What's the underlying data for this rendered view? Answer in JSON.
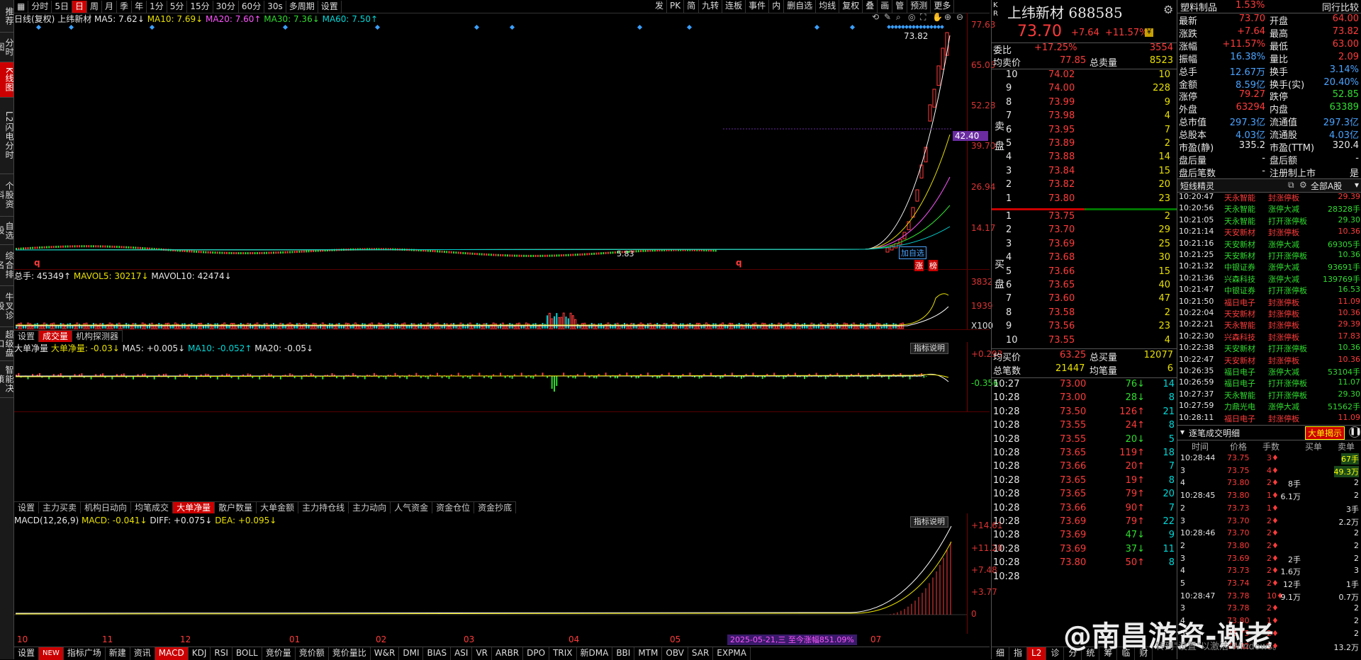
{
  "sidebar": [
    "推荐",
    "分时图",
    "K线图",
    "L2闪电分时",
    "个股资料",
    "自选股",
    "综合排名",
    "牛叉诊股",
    "超级盘口",
    "智能决策"
  ],
  "toolbar": {
    "left": [
      "分时",
      "5日",
      "日",
      "周",
      "月",
      "季",
      "年",
      "1分",
      "5分",
      "15分",
      "30分",
      "60分",
      "30s",
      "多周期",
      "设置"
    ],
    "active": "日",
    "right": [
      "发",
      "PK",
      "简",
      "九转",
      "连板",
      "事件",
      "内",
      "删自选",
      "均线",
      "复权",
      "叠",
      "画",
      "管",
      "预测",
      "更多"
    ]
  },
  "kline_legend": {
    "title": "日线(复权)",
    "name": "上纬新材",
    "ma5": "MA5: 7.62↓",
    "ma10": "MA10: 7.69↓",
    "ma20": "MA20: 7.60↑",
    "ma30": "MA30: 7.36↓",
    "ma60": "MA60: 7.50↑"
  },
  "kline_axis": [
    "77.63",
    "65.05",
    "52.28",
    "39.70",
    "26.94",
    "14.17"
  ],
  "kline_marker": "42.40",
  "kline_high": "73.82",
  "kline_low": "5.83",
  "kline_tags": [
    "加自选",
    "涨",
    "榜"
  ],
  "kline_q": [
    "q",
    "q"
  ],
  "vol_legend": {
    "total": "总手: 45349↑",
    "mavol5": "MAVOL5: 30217↓",
    "mavol10": "MAVOL10: 42474↓"
  },
  "vol_axis": [
    "3832",
    "1939",
    "X100"
  ],
  "vol_tabs": [
    "设置",
    "成交量",
    "机构探测器"
  ],
  "vol_tab_active": "成交量",
  "big_legend": {
    "title": "大单净量",
    "v": "大单净量: -0.03↓",
    "ma5": "MA5: +0.005↓",
    "ma10": "MA10: -0.052↑",
    "ma20": "MA20: -0.05↓"
  },
  "big_axis": [
    "+0.293",
    "-0.356"
  ],
  "indicator_btn": "指标说明",
  "big_tabs": [
    "设置",
    "主力买卖",
    "机构日动向",
    "均笔成交",
    "大单净量",
    "散户数量",
    "大单金额",
    "主力持仓线",
    "主力动向",
    "人气资金",
    "资金仓位",
    "资金抄底"
  ],
  "big_tab_active": "大单净量",
  "macd_legend": {
    "title": "MACD(12,26,9)",
    "macd": "MACD: -0.041↓",
    "diff": "DIFF: +0.075↓",
    "dea": "DEA: +0.095↓"
  },
  "macd_axis": [
    "+14.61",
    "+11.20",
    "+7.48",
    "+3.77",
    "0"
  ],
  "x_labels": [
    "10",
    "11",
    "12",
    "01",
    "02",
    "03",
    "04",
    "05",
    "06",
    "07"
  ],
  "date_tag": "2025-05-21,三 至今涨幅851.09%",
  "bottom_tabs": [
    "设置",
    "NEW",
    "指标广场",
    "新建",
    "资讯",
    "MACD",
    "KDJ",
    "RSI",
    "BOLL",
    "竞价量",
    "竞价额",
    "竞价量比",
    "W&R",
    "DMI",
    "BIAS",
    "ASI",
    "VR",
    "ARBR",
    "DPO",
    "TRIX",
    "新DMA",
    "BBI",
    "MTM",
    "OBV",
    "SAR",
    "EXPMA"
  ],
  "bottom_active": "MACD",
  "stock": {
    "name": "上纬新材",
    "code": "688585",
    "price": "73.70",
    "change": "+7.64",
    "pct": "+11.57%"
  },
  "weibi": {
    "label": "委比",
    "value": "+17.25%",
    "diff": "3554"
  },
  "avg_sell": {
    "label": "均卖价",
    "value": "77.85",
    "vol_label": "总卖量",
    "vol": "8523"
  },
  "sell_side": "卖盘",
  "buy_side": "买盘",
  "asks": [
    [
      "10",
      "74.02",
      "10"
    ],
    [
      "9",
      "74.00",
      "228"
    ],
    [
      "8",
      "73.99",
      "9"
    ],
    [
      "7",
      "73.98",
      "4"
    ],
    [
      "6",
      "73.95",
      "7"
    ],
    [
      "5",
      "73.89",
      "2"
    ],
    [
      "4",
      "73.88",
      "14"
    ],
    [
      "3",
      "73.84",
      "15"
    ],
    [
      "2",
      "73.82",
      "20"
    ],
    [
      "1",
      "73.80",
      "23"
    ]
  ],
  "bids": [
    [
      "1",
      "73.75",
      "2"
    ],
    [
      "2",
      "73.70",
      "29"
    ],
    [
      "3",
      "73.69",
      "25"
    ],
    [
      "4",
      "73.68",
      "30"
    ],
    [
      "5",
      "73.66",
      "15"
    ],
    [
      "6",
      "73.65",
      "40"
    ],
    [
      "7",
      "73.60",
      "47"
    ],
    [
      "8",
      "73.58",
      "2"
    ],
    [
      "9",
      "73.56",
      "23"
    ],
    [
      "10",
      "73.55",
      "4"
    ]
  ],
  "avg_buy": {
    "label": "均买价",
    "value": "63.25",
    "vol_label": "总买量",
    "vol": "12077"
  },
  "total_trades": {
    "label": "总笔数",
    "value": "21447",
    "vol_label": "均笔量",
    "vol": "6"
  },
  "ticks": [
    [
      "10:27",
      "73.00",
      "76↓",
      "14"
    ],
    [
      "10:28",
      "73.00",
      "28↓",
      "8"
    ],
    [
      "10:28",
      "73.50",
      "126↑",
      "21"
    ],
    [
      "10:28",
      "73.55",
      "24↑",
      "8"
    ],
    [
      "10:28",
      "73.55",
      "20↓",
      "5"
    ],
    [
      "10:28",
      "73.65",
      "119↑",
      "18"
    ],
    [
      "10:28",
      "73.66",
      "20↑",
      "7"
    ],
    [
      "10:28",
      "73.65",
      "19↑",
      "8"
    ],
    [
      "10:28",
      "73.65",
      "79↑",
      "20"
    ],
    [
      "10:28",
      "73.66",
      "90↑",
      "7"
    ],
    [
      "10:28",
      "73.69",
      "79↑",
      "22"
    ],
    [
      "10:28",
      "73.69",
      "47↓",
      "9"
    ],
    [
      "10:28",
      "73.69",
      "37↓",
      "11"
    ],
    [
      "10:28",
      "73.80",
      "50↑",
      "8"
    ],
    [
      "10:28",
      "",
      "",
      ""
    ]
  ],
  "quote_bottom_tabs": [
    "细",
    "指",
    "L2",
    "诊",
    "分",
    "统",
    "筹",
    "临",
    "财"
  ],
  "stats_header": {
    "name": "塑料制品",
    "pct": "1.53%",
    "right": "同行比较"
  },
  "stats": [
    [
      "最新",
      "73.70",
      "开盘",
      "64.00"
    ],
    [
      "涨跌",
      "+7.64",
      "最高",
      "73.82"
    ],
    [
      "涨幅",
      "+11.57%",
      "最低",
      "63.00"
    ],
    [
      "振幅",
      "16.38%",
      "量比",
      "2.09"
    ],
    [
      "总手",
      "12.67万",
      "换手",
      "3.14%"
    ],
    [
      "金额",
      "8.59亿",
      "换手(实)",
      "20.40%"
    ],
    [
      "涨停",
      "79.27",
      "跌停",
      "52.85"
    ],
    [
      "外盘",
      "63294",
      "内盘",
      "63389"
    ],
    [
      "总市值",
      "297.3亿",
      "流通值",
      "297.3亿"
    ],
    [
      "总股本",
      "4.03亿",
      "流通股",
      "4.03亿"
    ],
    [
      "市盈(静)",
      "335.2",
      "市盈(TTM)",
      "320.4"
    ],
    [
      "盘后量",
      "-",
      "盘后额",
      "-"
    ],
    [
      "盘后笔数",
      "-",
      "注册制上市",
      "是"
    ]
  ],
  "shortline": {
    "title": "短线精灵",
    "right": "全部A股"
  },
  "events": [
    [
      "10:20:47",
      "天永智能",
      "封涨停板",
      "29.39"
    ],
    [
      "10:20:56",
      "天永智能",
      "涨停大减",
      "28328手"
    ],
    [
      "10:21:05",
      "天永智能",
      "打开涨停板",
      "29.30"
    ],
    [
      "10:21:14",
      "天安新材",
      "封涨停板",
      "10.36"
    ],
    [
      "10:21:16",
      "天安新材",
      "涨停大减",
      "69305手"
    ],
    [
      "10:21:25",
      "天安新材",
      "打开涨停板",
      "10.36"
    ],
    [
      "10:21:32",
      "中银证券",
      "涨停大减",
      "93691手"
    ],
    [
      "10:21:36",
      "兴森科技",
      "涨停大减",
      "139769手"
    ],
    [
      "10:21:47",
      "中银证券",
      "打开涨停板",
      "16.53"
    ],
    [
      "10:21:50",
      "福日电子",
      "封涨停板",
      "11.09"
    ],
    [
      "10:22:04",
      "天安新材",
      "封涨停板",
      "10.36"
    ],
    [
      "10:22:21",
      "天永智能",
      "封涨停板",
      "29.39"
    ],
    [
      "10:22:30",
      "兴森科技",
      "封涨停板",
      "17.83"
    ],
    [
      "10:22:38",
      "天安新材",
      "打开涨停板",
      "10.36"
    ],
    [
      "10:22:47",
      "天安新材",
      "封涨停板",
      "10.36"
    ],
    [
      "10:26:35",
      "福日电子",
      "涨停大减",
      "53104手"
    ],
    [
      "10:26:59",
      "福日电子",
      "打开涨停板",
      "11.07"
    ],
    [
      "10:27:37",
      "天永智能",
      "打开涨停板",
      "29.30"
    ],
    [
      "10:27:59",
      "力鼎光电",
      "涨停大减",
      "51562手"
    ],
    [
      "10:28:11",
      "福日电子",
      "封涨停板",
      "11.09"
    ]
  ],
  "detail": {
    "title": "逐笔成交明细",
    "btn": "大单揭示",
    "cols": [
      "时间",
      "价格",
      "手数",
      "买单",
      "卖单"
    ]
  },
  "detail_rows": [
    [
      "10:28:44",
      "73.75",
      "3♦",
      "",
      "67手"
    ],
    [
      "3",
      "73.75",
      "4♦",
      "",
      "49.3万"
    ],
    [
      "4",
      "73.80",
      "2♦",
      "8手",
      "2"
    ],
    [
      "10:28:45",
      "73.80",
      "1♦",
      "6.1万",
      "2"
    ],
    [
      "2",
      "73.73",
      "1♦",
      "",
      "3手"
    ],
    [
      "3",
      "73.70",
      "2♦",
      "",
      "2.2万"
    ],
    [
      "10:28:46",
      "73.70",
      "2♦",
      "",
      "2"
    ],
    [
      "2",
      "73.80",
      "2♦",
      "",
      "2"
    ],
    [
      "3",
      "73.69",
      "2♦",
      "2手",
      "2"
    ],
    [
      "4",
      "73.73",
      "2♦",
      "1.6万",
      "3"
    ],
    [
      "5",
      "73.74",
      "2♦",
      "12手",
      "1手"
    ],
    [
      "10:28:47",
      "73.78",
      "10♦",
      "9.1万",
      "0.7万"
    ],
    [
      "3",
      "73.78",
      "2♦",
      "",
      "2"
    ],
    [
      "4",
      "73.80",
      "1♦",
      "",
      "2"
    ],
    [
      "5",
      "73.75",
      "2♦",
      "",
      "2"
    ],
    [
      "6",
      "73.82",
      "5♦",
      "",
      "13.2万"
    ]
  ],
  "watermark": "@南昌游资-谢老",
  "win_hint": "转到\"设置\"以激活 Windows。"
}
